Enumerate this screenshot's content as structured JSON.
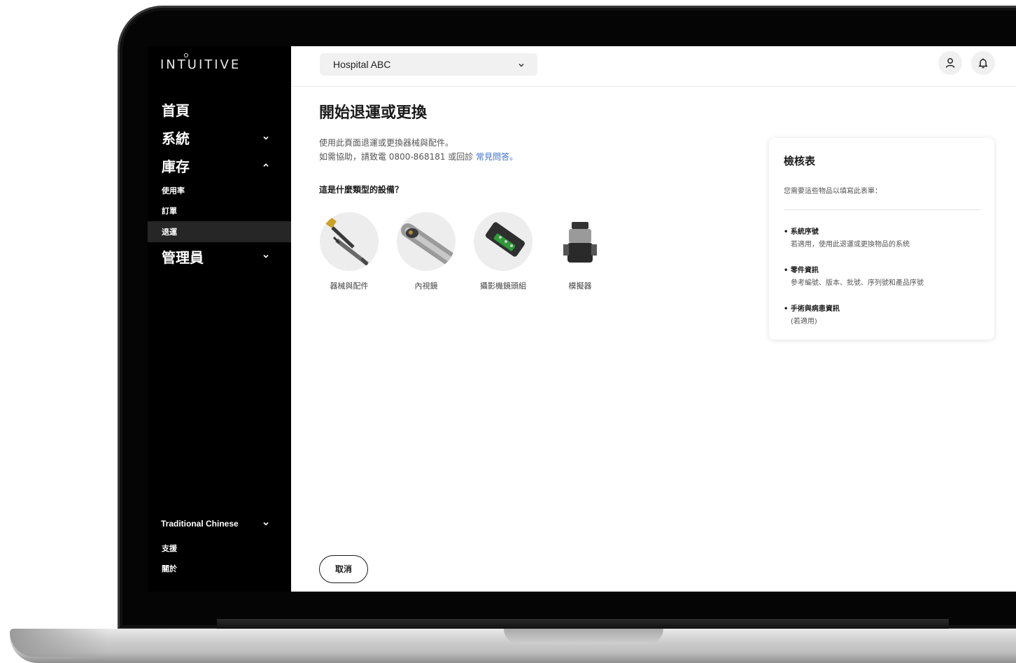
{
  "sidebar": {
    "logo": "INTUITIVE",
    "nav": [
      {
        "label": "首頁"
      },
      {
        "label": "系統"
      },
      {
        "label": "庫存"
      },
      {
        "label": "管理員"
      }
    ],
    "inventory_sub": [
      {
        "label": "使用率"
      },
      {
        "label": "訂單"
      },
      {
        "label": "退運"
      }
    ],
    "language": "Traditional Chinese",
    "footer": [
      {
        "label": "支援"
      },
      {
        "label": "關於"
      }
    ]
  },
  "header": {
    "hospital": "Hospital ABC"
  },
  "main": {
    "title": "開始退運或更換",
    "desc_line1": "使用此頁面退運或更換器械與配件。",
    "desc_line2_prefix": "如需協助，請致電 0800-868181 或回診",
    "desc_line2_link": "常見問答。",
    "question": "這是什麼類型的設備？",
    "devices": [
      {
        "label": "器械與配件",
        "icon": "instrument-icon"
      },
      {
        "label": "內視鏡",
        "icon": "endoscope-icon"
      },
      {
        "label": "攝影機鏡頭組",
        "icon": "camera-head-icon"
      },
      {
        "label": "模擬器",
        "icon": "simulator-icon"
      }
    ],
    "cancel": "取消"
  },
  "checklist": {
    "title": "檢核表",
    "subtitle": "您需要這些物品以填寫此表單：",
    "items": [
      {
        "head": "系統序號",
        "body": "若適用，使用此退運或更換物品的系統"
      },
      {
        "head": "零件資訊",
        "body": "參考編號、版本、批號、序列號和產品序號"
      },
      {
        "head": "手術與病患資訊",
        "body": "(若適用)"
      }
    ]
  },
  "colors": {
    "accent_link": "#3d6fd1",
    "sidebar_bg": "#000000",
    "active_item_bg": "#262626"
  }
}
